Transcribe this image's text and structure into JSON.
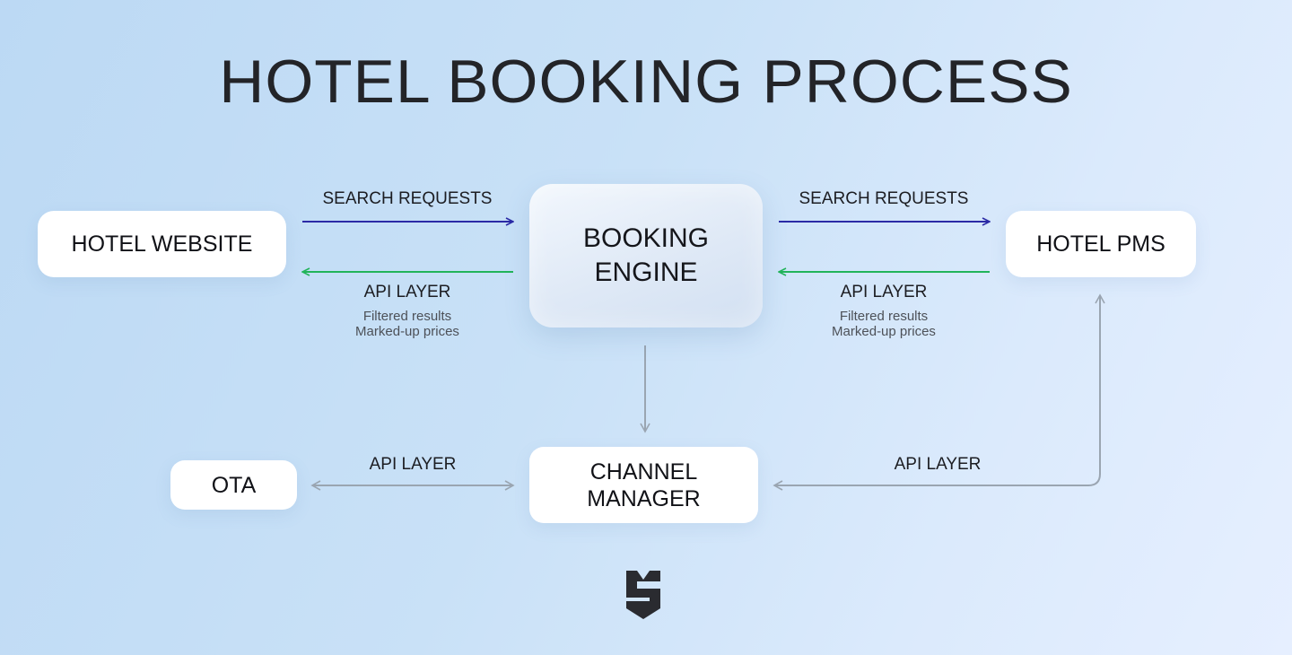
{
  "title": "HOTEL BOOKING PROCESS",
  "nodes": {
    "hotel_website": "HOTEL WEBSITE",
    "booking_engine": "BOOKING\nENGINE",
    "hotel_pms": "HOTEL PMS",
    "ota": "OTA",
    "channel_manager": "CHANNEL\nMANAGER"
  },
  "edges": {
    "left_request": "SEARCH REQUESTS",
    "right_request": "SEARCH REQUESTS",
    "left_response": "API LAYER",
    "left_response_note_1": "Filtered results",
    "left_response_note_2": "Marked-up prices",
    "right_response": "API LAYER",
    "right_response_note_1": "Filtered results",
    "right_response_note_2": "Marked-up prices",
    "ota_channel": "API LAYER",
    "pms_channel": "API LAYER"
  },
  "colors": {
    "request_arrow": "#2b2aa6",
    "response_arrow": "#22b45a",
    "neutral_arrow": "#9aa5b1"
  },
  "logo_icon": "s-shield-logo-icon"
}
